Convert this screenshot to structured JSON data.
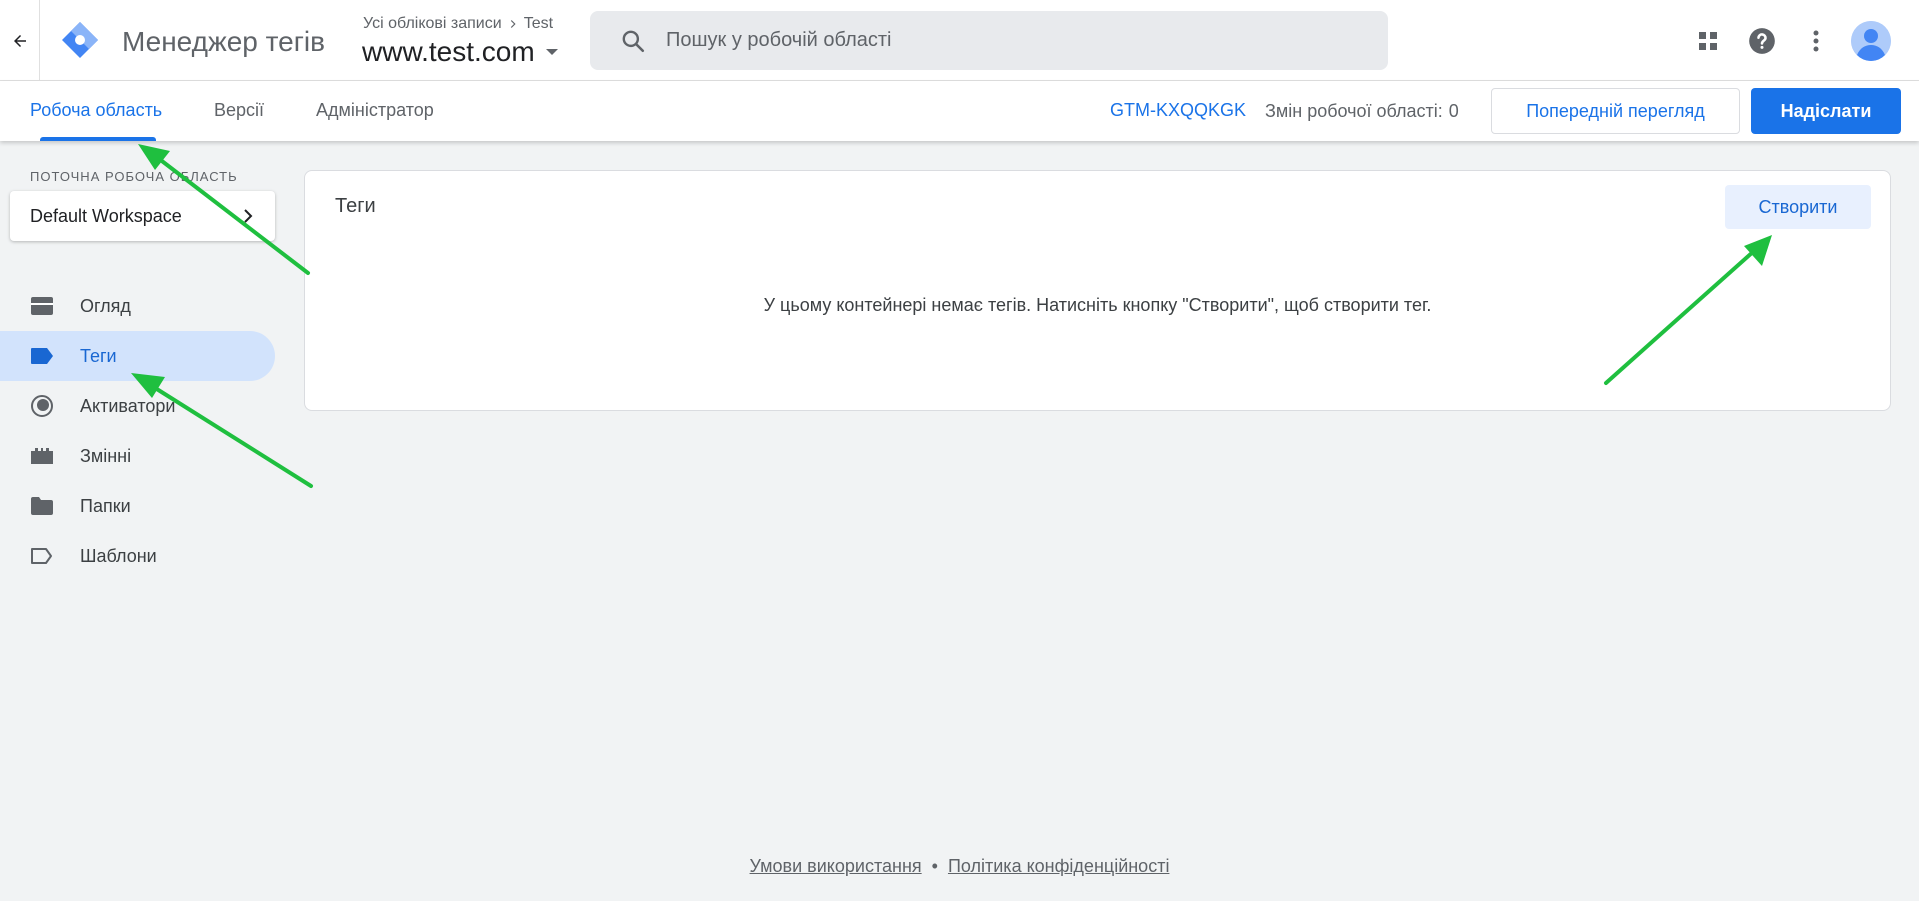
{
  "header": {
    "product_name": "Менеджер тегів",
    "breadcrumb_account_list": "Усі облікові записи",
    "breadcrumb_account": "Test",
    "container_name": "www.test.com",
    "search_placeholder": "Пошук у робочій області"
  },
  "nav": {
    "tabs": [
      {
        "label": "Робоча область"
      },
      {
        "label": "Версії"
      },
      {
        "label": "Адміністратор"
      }
    ],
    "gtm_id": "GTM-KXQQKGK",
    "changes_label": "Змін робочої області:",
    "changes_count": "0",
    "preview_label": "Попередній перегляд",
    "submit_label": "Надіслати"
  },
  "sidebar": {
    "workspace_label": "ПОТОЧНА РОБОЧА ОБЛАСТЬ",
    "workspace_name": "Default Workspace",
    "items": [
      {
        "label": "Огляд",
        "icon": "overview-icon"
      },
      {
        "label": "Теги",
        "icon": "tag-icon"
      },
      {
        "label": "Активатори",
        "icon": "trigger-icon"
      },
      {
        "label": "Змінні",
        "icon": "variables-icon"
      },
      {
        "label": "Папки",
        "icon": "folder-icon"
      },
      {
        "label": "Шаблони",
        "icon": "template-icon"
      }
    ]
  },
  "main": {
    "title": "Теги",
    "create_label": "Створити",
    "empty_message": "У цьому контейнері немає тегів. Натисніть кнопку \"Створити\", щоб створити тег."
  },
  "footer": {
    "terms": "Умови використання",
    "separator": "•",
    "privacy": "Політика конфіденційності"
  },
  "colors": {
    "accent": "#1a73e8",
    "annotation_arrow": "#1fbf3f"
  }
}
